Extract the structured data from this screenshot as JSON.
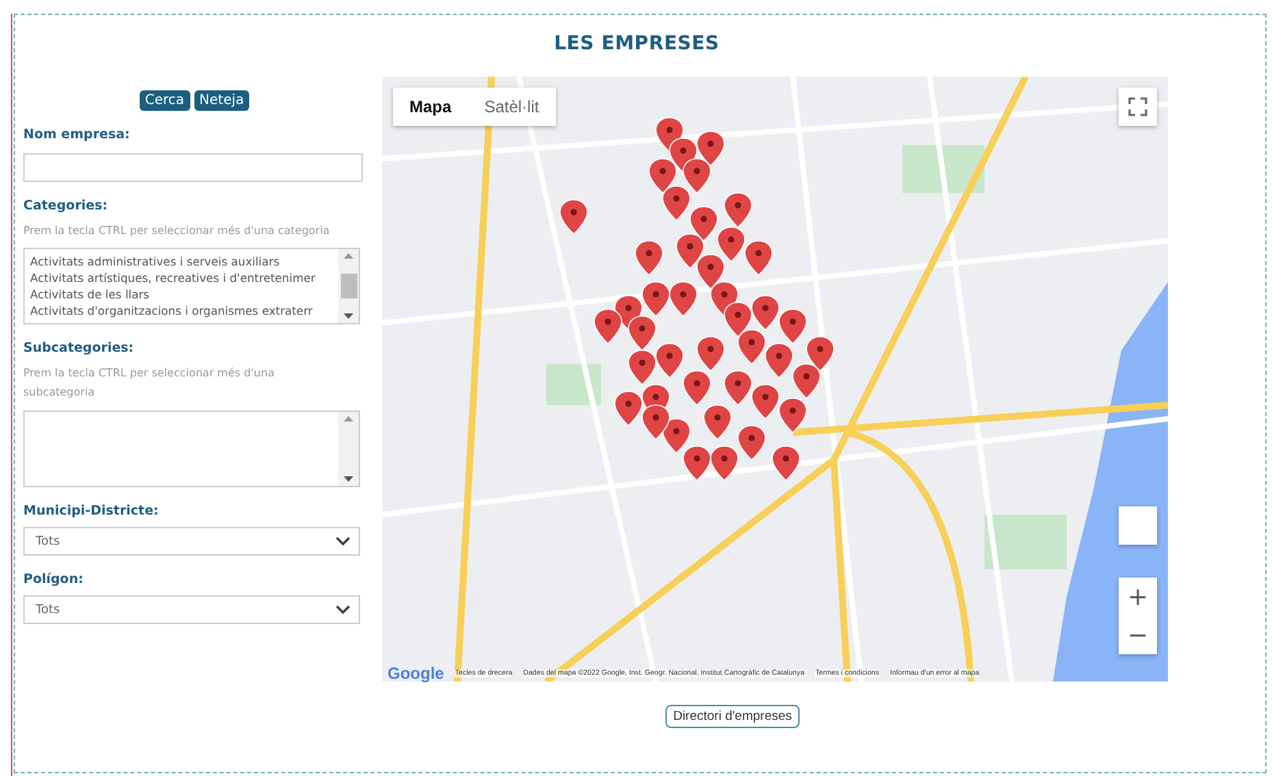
{
  "title": "LES EMPRESES",
  "search_buttons": [
    "Cerca",
    "Neteja"
  ],
  "filters": {
    "company_name": {
      "label": "Nom empresa:"
    },
    "categories": {
      "label": "Categories:",
      "hint": "Prem la tecla CTRL per seleccionar més d'una categoria",
      "options": [
        "Activitats administratives i serveis auxiliars",
        "Activitats artístiques, recreatives i d'entretenimer",
        "Activitats de les llars",
        "Activitats d'organitzacions i organismes extraterr"
      ]
    },
    "subcategories": {
      "label": "Subcategories:",
      "hint": "Prem la tecla CTRL per seleccionar més d'una subcategoria"
    },
    "district": {
      "label": "Municipi-Districte:",
      "value": "Tots"
    },
    "polygon": {
      "label": "Polígon:",
      "value": "Tots"
    }
  },
  "map": {
    "map_types": [
      {
        "label": "Mapa",
        "selected": true
      },
      {
        "label": "Satèl·lit",
        "selected": false
      }
    ],
    "logo": "Google",
    "attribution": [
      "Tecles de drecera",
      "Dades del mapa ©2022 Google, Inst. Geogr. Nacional, Institut Cartogràfic de Catalunya",
      "Termes i condicions",
      "Informau d'un error al mapa"
    ],
    "zoom_in": "+",
    "zoom_out": "−"
  },
  "directory_button": "Directori d'empreses"
}
